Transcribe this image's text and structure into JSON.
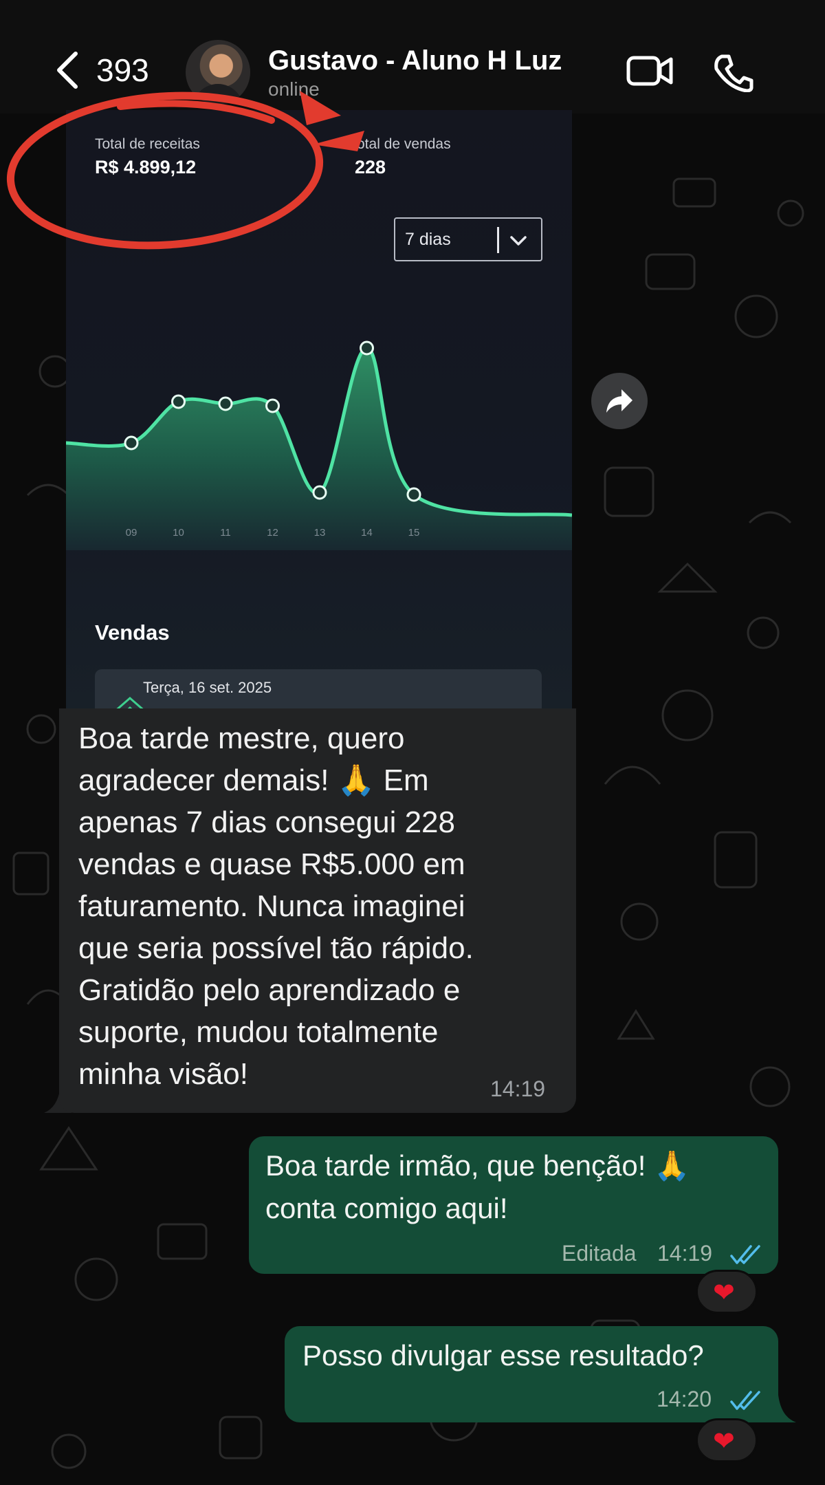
{
  "header": {
    "unread_count": "393",
    "contact_name": "Gustavo - Aluno H Luz",
    "status": "online",
    "icons": [
      "back-chevron-icon",
      "video-call-icon",
      "phone-icon"
    ]
  },
  "shared_screenshot": {
    "total_receitas_label": "Total de receitas",
    "total_receitas_value": "R$ 4.899,12",
    "total_vendas_label": "otal de vendas",
    "total_vendas_value": "228",
    "period_selector": "7 dias",
    "section_title": "Vendas",
    "sale_date": "Terça, 16 set. 2025"
  },
  "chart_data": {
    "type": "area",
    "categories": [
      "09",
      "10",
      "11",
      "12",
      "13",
      "14",
      "15"
    ],
    "series": [
      {
        "values": [
          0.42,
          0.62,
          0.61,
          0.6,
          0.18,
          0.88,
          0.17
        ]
      }
    ],
    "ylim": [
      0,
      1
    ],
    "grid": "vertical lines at each category",
    "color": "#3ecf8e"
  },
  "messages": [
    {
      "direction": "incoming",
      "text": "Boa tarde mestre, quero\nagradecer demais! 🙏 Em\napenas 7 dias consegui 228\nvendas e quase R$5.000 em\nfaturamento. Nunca imaginei\nque seria possível tão rápido.\nGratidão pelo aprendizado e\nsuporte, mudou totalmente\nminha visão!",
      "time": "14:19"
    },
    {
      "direction": "outgoing",
      "text": "Boa tarde irmão, que benção! 🙏\nconta comigo aqui!",
      "edited_label": "Editada",
      "time": "14:19",
      "reaction": "❤"
    },
    {
      "direction": "outgoing",
      "text": "Posso divulgar esse resultado?",
      "time": "14:20",
      "reaction": "❤"
    }
  ],
  "colors": {
    "outgoing_bubble": "#144d37",
    "incoming_bubble": "#222324",
    "read_ticks": "#53bdeb",
    "annotation_red": "#e23b2e"
  }
}
